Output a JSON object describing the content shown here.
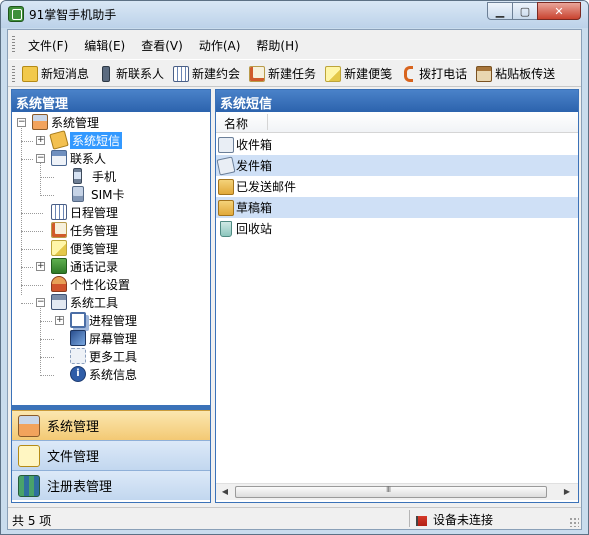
{
  "window": {
    "title": "91掌智手机助手"
  },
  "menu": [
    "文件(F)",
    "编辑(E)",
    "查看(V)",
    "动作(A)",
    "帮助(H)"
  ],
  "toolbar": [
    {
      "label": "新短消息",
      "icon": "new-message-icon"
    },
    {
      "label": "新联系人",
      "icon": "new-contact-icon"
    },
    {
      "label": "新建约会",
      "icon": "calendar-icon"
    },
    {
      "label": "新建任务",
      "icon": "task-icon"
    },
    {
      "label": "新建便笺",
      "icon": "note-icon"
    },
    {
      "label": "拨打电话",
      "icon": "phone-icon"
    },
    {
      "label": "粘贴板传送",
      "icon": "clipboard-icon"
    }
  ],
  "left_panel": {
    "header": "系统管理",
    "tree": [
      {
        "label": "系统管理",
        "icon": "home-icon"
      },
      {
        "label": "系统短信",
        "icon": "sms-icon",
        "selected": true
      },
      {
        "label": "联系人",
        "icon": "contacts-icon"
      },
      {
        "label": "手机",
        "icon": "mobile-icon"
      },
      {
        "label": "SIM卡",
        "icon": "sim-icon"
      },
      {
        "label": "日程管理",
        "icon": "calendar-icon"
      },
      {
        "label": "任务管理",
        "icon": "task-icon"
      },
      {
        "label": "便笺管理",
        "icon": "note-icon"
      },
      {
        "label": "通话记录",
        "icon": "call-log-icon"
      },
      {
        "label": "个性化设置",
        "icon": "user-settings-icon"
      },
      {
        "label": "系统工具",
        "icon": "tools-icon"
      },
      {
        "label": "进程管理",
        "icon": "process-icon"
      },
      {
        "label": "屏幕管理",
        "icon": "screen-icon"
      },
      {
        "label": "更多工具",
        "icon": "more-tools-icon"
      },
      {
        "label": "系统信息",
        "icon": "info-icon"
      }
    ],
    "nav_buttons": [
      {
        "label": "系统管理",
        "icon": "home-icon",
        "active": true
      },
      {
        "label": "文件管理",
        "icon": "file-manager-icon"
      },
      {
        "label": "注册表管理",
        "icon": "registry-icon"
      }
    ]
  },
  "right_panel": {
    "header": "系统短信",
    "column": "名称",
    "rows": [
      {
        "label": "收件箱",
        "icon": "inbox-icon"
      },
      {
        "label": "发件箱",
        "icon": "outbox-icon"
      },
      {
        "label": "已发送邮件",
        "icon": "sent-folder-icon"
      },
      {
        "label": "草稿箱",
        "icon": "drafts-folder-icon"
      },
      {
        "label": "回收站",
        "icon": "recycle-bin-icon"
      }
    ]
  },
  "status": {
    "count": "共 5 项",
    "device": "设备未连接"
  },
  "colors": {
    "accent": "#2c63ad",
    "selection": "#3399ff",
    "row_alt": "#cfe0f6",
    "nav_active": "#f3c974"
  }
}
